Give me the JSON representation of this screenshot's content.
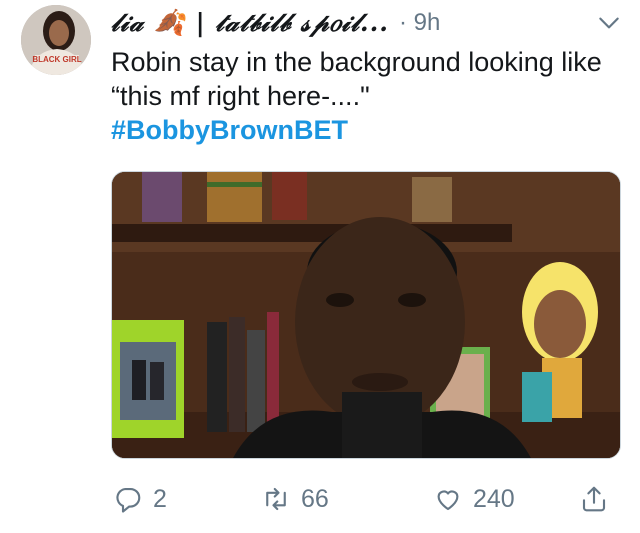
{
  "author": {
    "display_name": "𝓁𝒾𝒶 🍂 | 𝓉𝒶𝓉𝒷𝒾𝓁𝒷 𝓈𝓅𝑜𝒾𝓁...",
    "time": "· 9h",
    "avatar_shirt_text": "BLACK GIRL"
  },
  "tweet": {
    "text": "Robin stay in the background looking like “this mf right here-....\"",
    "hashtag": "#BobbyBrownBET"
  },
  "actions": {
    "reply_count": "2",
    "retweet_count": "66",
    "like_count": "240"
  },
  "colors": {
    "hashtag": "#1b95e0",
    "secondary_text": "#657786"
  },
  "icons": [
    "chevron-down-icon",
    "reply-icon",
    "retweet-icon",
    "like-icon",
    "share-icon"
  ]
}
